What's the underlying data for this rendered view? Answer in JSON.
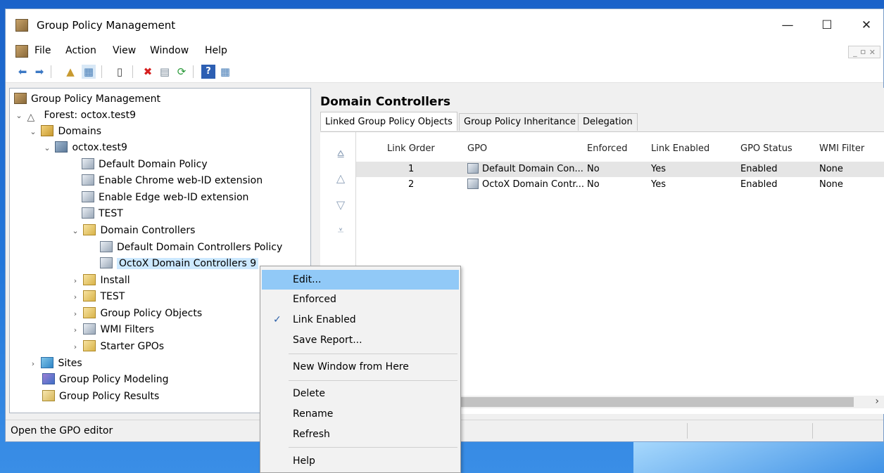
{
  "window": {
    "title": "Group Policy Management",
    "controls": {
      "minimize": "—",
      "maximize": "☐",
      "close": "✕"
    }
  },
  "menubar": {
    "items": [
      "File",
      "Action",
      "View",
      "Window",
      "Help"
    ],
    "mdi_controls": "_ ㅁ ✕"
  },
  "tree": {
    "root": "Group Policy Management",
    "forest": "Forest: octox.test9",
    "domains": "Domains",
    "domain": "octox.test9",
    "gpos": [
      "Default Domain Policy",
      "Enable Chrome web-ID extension",
      "Enable Edge web-ID extension",
      "TEST"
    ],
    "dc_ou": "Domain Controllers",
    "dc_gpos": [
      "Default Domain Controllers Policy",
      "OctoX Domain Controllers 9"
    ],
    "ous": [
      "Install",
      "TEST"
    ],
    "containers": [
      "Group Policy Objects",
      "WMI Filters",
      "Starter GPOs"
    ],
    "sites": "Sites",
    "modeling": "Group Policy Modeling",
    "results": "Group Policy Results"
  },
  "details": {
    "title": "Domain Controllers",
    "tabs": [
      "Linked Group Policy Objects",
      "Group Policy Inheritance",
      "Delegation"
    ],
    "columns": [
      "Link Order",
      "GPO",
      "Enforced",
      "Link Enabled",
      "GPO Status",
      "WMI Filter"
    ],
    "rows": [
      {
        "order": "1",
        "gpo": "Default Domain Con...",
        "enforced": "No",
        "link_enabled": "Yes",
        "status": "Enabled",
        "wmi": "None"
      },
      {
        "order": "2",
        "gpo": "OctoX Domain Contr...",
        "enforced": "No",
        "link_enabled": "Yes",
        "status": "Enabled",
        "wmi": "None"
      }
    ]
  },
  "context_menu": {
    "items": [
      "Edit...",
      "Enforced",
      "Link Enabled",
      "Save Report...",
      "New Window from Here",
      "Delete",
      "Rename",
      "Refresh",
      "Help"
    ]
  },
  "status": {
    "text": "Open the GPO editor"
  }
}
